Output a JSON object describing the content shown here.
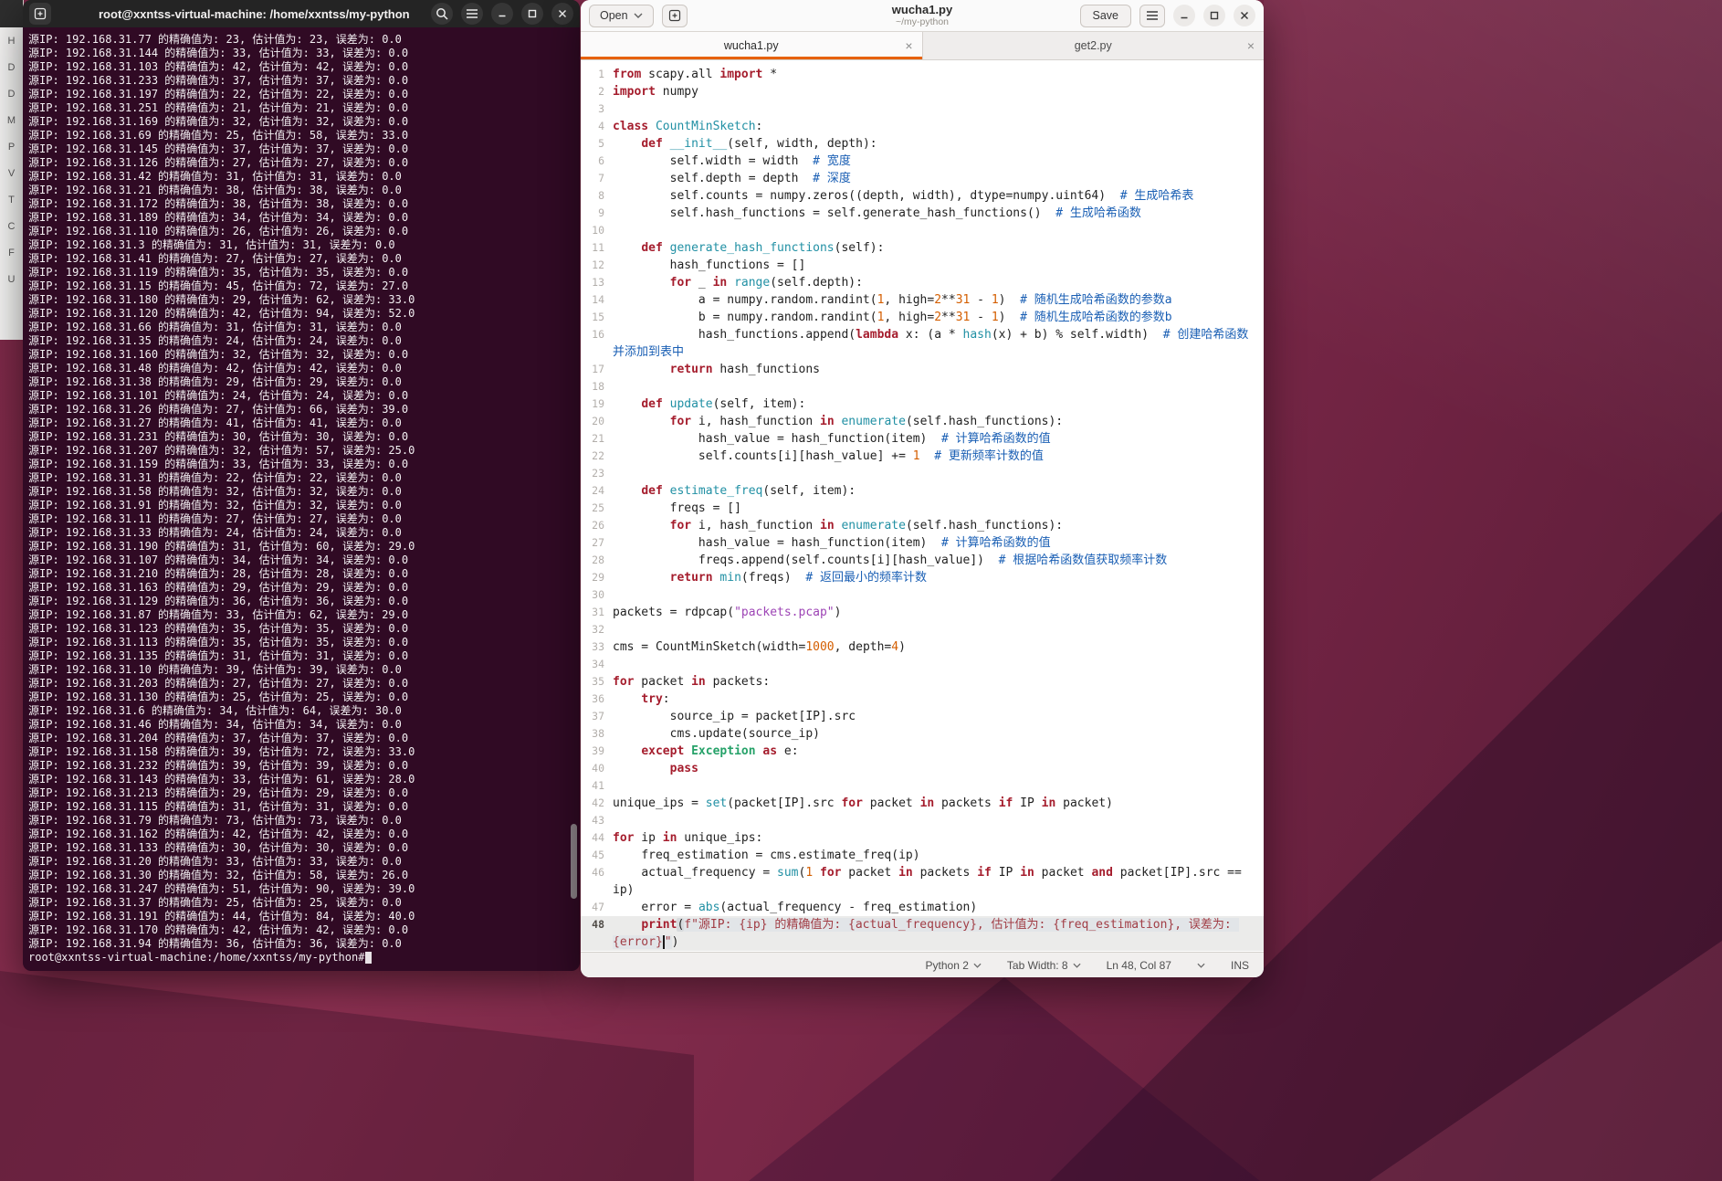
{
  "colors": {
    "accent_orange": "#e66100",
    "terminal_background": "#300a24",
    "desktop_base": "#7b2847",
    "keyword_red": "#a51d2d",
    "comment_blue": "#1a5fb4",
    "string_purple": "#9d44b5"
  },
  "icons": {
    "close": "×"
  },
  "background_strip": {
    "items": [
      "H",
      "D",
      "D",
      "M",
      "P",
      "V",
      "T",
      "C",
      "F",
      "U"
    ]
  },
  "terminal": {
    "header": {
      "title": "root@xxntss-virtual-machine: /home/xxntss/my-python"
    },
    "prompt": "root@xxntss-virtual-machine:/home/xxntss/my-python#",
    "lines": [
      "源IP: 192.168.31.77 的精确值为: 23, 估计值为: 23, 误差为: 0.0",
      "源IP: 192.168.31.144 的精确值为: 33, 估计值为: 33, 误差为: 0.0",
      "源IP: 192.168.31.103 的精确值为: 42, 估计值为: 42, 误差为: 0.0",
      "源IP: 192.168.31.233 的精确值为: 37, 估计值为: 37, 误差为: 0.0",
      "源IP: 192.168.31.197 的精确值为: 22, 估计值为: 22, 误差为: 0.0",
      "源IP: 192.168.31.251 的精确值为: 21, 估计值为: 21, 误差为: 0.0",
      "源IP: 192.168.31.169 的精确值为: 32, 估计值为: 32, 误差为: 0.0",
      "源IP: 192.168.31.69 的精确值为: 25, 估计值为: 58, 误差为: 33.0",
      "源IP: 192.168.31.145 的精确值为: 37, 估计值为: 37, 误差为: 0.0",
      "源IP: 192.168.31.126 的精确值为: 27, 估计值为: 27, 误差为: 0.0",
      "源IP: 192.168.31.42 的精确值为: 31, 估计值为: 31, 误差为: 0.0",
      "源IP: 192.168.31.21 的精确值为: 38, 估计值为: 38, 误差为: 0.0",
      "源IP: 192.168.31.172 的精确值为: 38, 估计值为: 38, 误差为: 0.0",
      "源IP: 192.168.31.189 的精确值为: 34, 估计值为: 34, 误差为: 0.0",
      "源IP: 192.168.31.110 的精确值为: 26, 估计值为: 26, 误差为: 0.0",
      "源IP: 192.168.31.3 的精确值为: 31, 估计值为: 31, 误差为: 0.0",
      "源IP: 192.168.31.41 的精确值为: 27, 估计值为: 27, 误差为: 0.0",
      "源IP: 192.168.31.119 的精确值为: 35, 估计值为: 35, 误差为: 0.0",
      "源IP: 192.168.31.15 的精确值为: 45, 估计值为: 72, 误差为: 27.0",
      "源IP: 192.168.31.180 的精确值为: 29, 估计值为: 62, 误差为: 33.0",
      "源IP: 192.168.31.120 的精确值为: 42, 估计值为: 94, 误差为: 52.0",
      "源IP: 192.168.31.66 的精确值为: 31, 估计值为: 31, 误差为: 0.0",
      "源IP: 192.168.31.35 的精确值为: 24, 估计值为: 24, 误差为: 0.0",
      "源IP: 192.168.31.160 的精确值为: 32, 估计值为: 32, 误差为: 0.0",
      "源IP: 192.168.31.48 的精确值为: 42, 估计值为: 42, 误差为: 0.0",
      "源IP: 192.168.31.38 的精确值为: 29, 估计值为: 29, 误差为: 0.0",
      "源IP: 192.168.31.101 的精确值为: 24, 估计值为: 24, 误差为: 0.0",
      "源IP: 192.168.31.26 的精确值为: 27, 估计值为: 66, 误差为: 39.0",
      "源IP: 192.168.31.27 的精确值为: 41, 估计值为: 41, 误差为: 0.0",
      "源IP: 192.168.31.231 的精确值为: 30, 估计值为: 30, 误差为: 0.0",
      "源IP: 192.168.31.207 的精确值为: 32, 估计值为: 57, 误差为: 25.0",
      "源IP: 192.168.31.159 的精确值为: 33, 估计值为: 33, 误差为: 0.0",
      "源IP: 192.168.31.31 的精确值为: 22, 估计值为: 22, 误差为: 0.0",
      "源IP: 192.168.31.58 的精确值为: 32, 估计值为: 32, 误差为: 0.0",
      "源IP: 192.168.31.91 的精确值为: 32, 估计值为: 32, 误差为: 0.0",
      "源IP: 192.168.31.11 的精确值为: 27, 估计值为: 27, 误差为: 0.0",
      "源IP: 192.168.31.33 的精确值为: 24, 估计值为: 24, 误差为: 0.0",
      "源IP: 192.168.31.190 的精确值为: 31, 估计值为: 60, 误差为: 29.0",
      "源IP: 192.168.31.107 的精确值为: 34, 估计值为: 34, 误差为: 0.0",
      "源IP: 192.168.31.210 的精确值为: 28, 估计值为: 28, 误差为: 0.0",
      "源IP: 192.168.31.163 的精确值为: 29, 估计值为: 29, 误差为: 0.0",
      "源IP: 192.168.31.129 的精确值为: 36, 估计值为: 36, 误差为: 0.0",
      "源IP: 192.168.31.87 的精确值为: 33, 估计值为: 62, 误差为: 29.0",
      "源IP: 192.168.31.123 的精确值为: 35, 估计值为: 35, 误差为: 0.0",
      "源IP: 192.168.31.113 的精确值为: 35, 估计值为: 35, 误差为: 0.0",
      "源IP: 192.168.31.135 的精确值为: 31, 估计值为: 31, 误差为: 0.0",
      "源IP: 192.168.31.10 的精确值为: 39, 估计值为: 39, 误差为: 0.0",
      "源IP: 192.168.31.203 的精确值为: 27, 估计值为: 27, 误差为: 0.0",
      "源IP: 192.168.31.130 的精确值为: 25, 估计值为: 25, 误差为: 0.0",
      "源IP: 192.168.31.6 的精确值为: 34, 估计值为: 64, 误差为: 30.0",
      "源IP: 192.168.31.46 的精确值为: 34, 估计值为: 34, 误差为: 0.0",
      "源IP: 192.168.31.204 的精确值为: 37, 估计值为: 37, 误差为: 0.0",
      "源IP: 192.168.31.158 的精确值为: 39, 估计值为: 72, 误差为: 33.0",
      "源IP: 192.168.31.232 的精确值为: 39, 估计值为: 39, 误差为: 0.0",
      "源IP: 192.168.31.143 的精确值为: 33, 估计值为: 61, 误差为: 28.0",
      "源IP: 192.168.31.213 的精确值为: 29, 估计值为: 29, 误差为: 0.0",
      "源IP: 192.168.31.115 的精确值为: 31, 估计值为: 31, 误差为: 0.0",
      "源IP: 192.168.31.79 的精确值为: 73, 估计值为: 73, 误差为: 0.0",
      "源IP: 192.168.31.162 的精确值为: 42, 估计值为: 42, 误差为: 0.0",
      "源IP: 192.168.31.133 的精确值为: 30, 估计值为: 30, 误差为: 0.0",
      "源IP: 192.168.31.20 的精确值为: 33, 估计值为: 33, 误差为: 0.0",
      "源IP: 192.168.31.30 的精确值为: 32, 估计值为: 58, 误差为: 26.0",
      "源IP: 192.168.31.247 的精确值为: 51, 估计值为: 90, 误差为: 39.0",
      "源IP: 192.168.31.37 的精确值为: 25, 估计值为: 25, 误差为: 0.0",
      "源IP: 192.168.31.191 的精确值为: 44, 估计值为: 84, 误差为: 40.0",
      "源IP: 192.168.31.170 的精确值为: 42, 估计值为: 42, 误差为: 0.0",
      "源IP: 192.168.31.94 的精确值为: 36, 估计值为: 36, 误差为: 0.0"
    ]
  },
  "editor": {
    "header": {
      "open_label": "Open",
      "title": "wucha1.py",
      "subtitle": "~/my-python",
      "save_label": "Save"
    },
    "tabs": [
      {
        "label": "wucha1.py",
        "active": true
      },
      {
        "label": "get2.py",
        "active": false
      }
    ],
    "status": {
      "language": "Python 2",
      "tab_width": "Tab Width: 8",
      "position": "Ln 48, Col 87",
      "mode": "INS"
    },
    "code": [
      {
        "n": 1,
        "tok": [
          [
            "k",
            "from"
          ],
          [
            "t",
            " scapy.all "
          ],
          [
            "k",
            "import"
          ],
          [
            "t",
            " *"
          ]
        ]
      },
      {
        "n": 2,
        "tok": [
          [
            "k",
            "import"
          ],
          [
            "t",
            " numpy"
          ]
        ]
      },
      {
        "n": 3,
        "tok": []
      },
      {
        "n": 4,
        "tok": [
          [
            "k",
            "class"
          ],
          [
            "t",
            " "
          ],
          [
            "fn",
            "CountMinSketch"
          ],
          [
            "t",
            ":"
          ]
        ]
      },
      {
        "n": 5,
        "tok": [
          [
            "t",
            "    "
          ],
          [
            "k",
            "def"
          ],
          [
            "t",
            " "
          ],
          [
            "fn",
            "__init__"
          ],
          [
            "t",
            "(self, width, depth):"
          ]
        ]
      },
      {
        "n": 6,
        "tok": [
          [
            "t",
            "        self.width = width  "
          ],
          [
            "c",
            "# 宽度"
          ]
        ]
      },
      {
        "n": 7,
        "tok": [
          [
            "t",
            "        self.depth = depth  "
          ],
          [
            "c",
            "# 深度"
          ]
        ]
      },
      {
        "n": 8,
        "tok": [
          [
            "t",
            "        self.counts = numpy.zeros((depth, width), dtype=numpy.uint64)  "
          ],
          [
            "c",
            "# 生成哈希表"
          ]
        ]
      },
      {
        "n": 9,
        "tok": [
          [
            "t",
            "        self.hash_functions = self.generate_hash_functions()  "
          ],
          [
            "c",
            "# 生成哈希函数"
          ]
        ]
      },
      {
        "n": 10,
        "tok": []
      },
      {
        "n": 11,
        "tok": [
          [
            "t",
            "    "
          ],
          [
            "k",
            "def"
          ],
          [
            "t",
            " "
          ],
          [
            "fn",
            "generate_hash_functions"
          ],
          [
            "t",
            "(self):"
          ]
        ]
      },
      {
        "n": 12,
        "tok": [
          [
            "t",
            "        hash_functions = []"
          ]
        ]
      },
      {
        "n": 13,
        "tok": [
          [
            "t",
            "        "
          ],
          [
            "k",
            "for"
          ],
          [
            "t",
            " _ "
          ],
          [
            "k",
            "in"
          ],
          [
            "t",
            " "
          ],
          [
            "fn",
            "range"
          ],
          [
            "t",
            "(self.depth):"
          ]
        ]
      },
      {
        "n": 14,
        "tok": [
          [
            "t",
            "            a = numpy.random.randint("
          ],
          [
            "n",
            "1"
          ],
          [
            "t",
            ", high="
          ],
          [
            "n",
            "2"
          ],
          [
            "t",
            "**"
          ],
          [
            "n",
            "31"
          ],
          [
            "t",
            " - "
          ],
          [
            "n",
            "1"
          ],
          [
            "t",
            ")  "
          ],
          [
            "c",
            "# 随机生成哈希函数的参数a"
          ]
        ]
      },
      {
        "n": 15,
        "tok": [
          [
            "t",
            "            b = numpy.random.randint("
          ],
          [
            "n",
            "1"
          ],
          [
            "t",
            ", high="
          ],
          [
            "n",
            "2"
          ],
          [
            "t",
            "**"
          ],
          [
            "n",
            "31"
          ],
          [
            "t",
            " - "
          ],
          [
            "n",
            "1"
          ],
          [
            "t",
            ")  "
          ],
          [
            "c",
            "# 随机生成哈希函数的参数b"
          ]
        ]
      },
      {
        "n": 16,
        "tok": [
          [
            "t",
            "            hash_functions.append("
          ],
          [
            "k",
            "lambda"
          ],
          [
            "t",
            " x: (a * "
          ],
          [
            "fn",
            "hash"
          ],
          [
            "t",
            "(x) + b) % self.width)  "
          ],
          [
            "c",
            "# 创建哈希函数并添加到表中"
          ]
        ]
      },
      {
        "n": 17,
        "tok": [
          [
            "t",
            "        "
          ],
          [
            "k",
            "return"
          ],
          [
            "t",
            " hash_functions"
          ]
        ]
      },
      {
        "n": 18,
        "tok": []
      },
      {
        "n": 19,
        "tok": [
          [
            "t",
            "    "
          ],
          [
            "k",
            "def"
          ],
          [
            "t",
            " "
          ],
          [
            "fn",
            "update"
          ],
          [
            "t",
            "(self, item):"
          ]
        ]
      },
      {
        "n": 20,
        "tok": [
          [
            "t",
            "        "
          ],
          [
            "k",
            "for"
          ],
          [
            "t",
            " i, hash_function "
          ],
          [
            "k",
            "in"
          ],
          [
            "t",
            " "
          ],
          [
            "fn",
            "enumerate"
          ],
          [
            "t",
            "(self.hash_functions):"
          ]
        ]
      },
      {
        "n": 21,
        "tok": [
          [
            "t",
            "            hash_value = hash_function(item)  "
          ],
          [
            "c",
            "# 计算哈希函数的值"
          ]
        ]
      },
      {
        "n": 22,
        "tok": [
          [
            "t",
            "            self.counts[i][hash_value] += "
          ],
          [
            "n",
            "1"
          ],
          [
            "t",
            "  "
          ],
          [
            "c",
            "# 更新频率计数的值"
          ]
        ]
      },
      {
        "n": 23,
        "tok": []
      },
      {
        "n": 24,
        "tok": [
          [
            "t",
            "    "
          ],
          [
            "k",
            "def"
          ],
          [
            "t",
            " "
          ],
          [
            "fn",
            "estimate_freq"
          ],
          [
            "t",
            "(self, item):"
          ]
        ]
      },
      {
        "n": 25,
        "tok": [
          [
            "t",
            "        freqs = []"
          ]
        ]
      },
      {
        "n": 26,
        "tok": [
          [
            "t",
            "        "
          ],
          [
            "k",
            "for"
          ],
          [
            "t",
            " i, hash_function "
          ],
          [
            "k",
            "in"
          ],
          [
            "t",
            " "
          ],
          [
            "fn",
            "enumerate"
          ],
          [
            "t",
            "(self.hash_functions):"
          ]
        ]
      },
      {
        "n": 27,
        "tok": [
          [
            "t",
            "            hash_value = hash_function(item)  "
          ],
          [
            "c",
            "# 计算哈希函数的值"
          ]
        ]
      },
      {
        "n": 28,
        "tok": [
          [
            "t",
            "            freqs.append(self.counts[i][hash_value])  "
          ],
          [
            "c",
            "# 根据哈希函数值获取频率计数"
          ]
        ]
      },
      {
        "n": 29,
        "tok": [
          [
            "t",
            "        "
          ],
          [
            "k",
            "return"
          ],
          [
            "t",
            " "
          ],
          [
            "fn",
            "min"
          ],
          [
            "t",
            "(freqs)  "
          ],
          [
            "c",
            "# 返回最小的频率计数"
          ]
        ]
      },
      {
        "n": 30,
        "tok": []
      },
      {
        "n": 31,
        "tok": [
          [
            "t",
            "packets = rdpcap("
          ],
          [
            "s",
            "\"packets.pcap\""
          ],
          [
            "t",
            ")"
          ]
        ]
      },
      {
        "n": 32,
        "tok": []
      },
      {
        "n": 33,
        "tok": [
          [
            "t",
            "cms = CountMinSketch(width="
          ],
          [
            "n",
            "1000"
          ],
          [
            "t",
            ", depth="
          ],
          [
            "n",
            "4"
          ],
          [
            "t",
            ")"
          ]
        ]
      },
      {
        "n": 34,
        "tok": []
      },
      {
        "n": 35,
        "tok": [
          [
            "k",
            "for"
          ],
          [
            "t",
            " packet "
          ],
          [
            "k",
            "in"
          ],
          [
            "t",
            " packets:"
          ]
        ]
      },
      {
        "n": 36,
        "tok": [
          [
            "t",
            "    "
          ],
          [
            "k",
            "try"
          ],
          [
            "t",
            ":"
          ]
        ]
      },
      {
        "n": 37,
        "tok": [
          [
            "t",
            "        source_ip = packet[IP].src"
          ]
        ]
      },
      {
        "n": 38,
        "tok": [
          [
            "t",
            "        cms.update(source_ip)"
          ]
        ]
      },
      {
        "n": 39,
        "tok": [
          [
            "t",
            "    "
          ],
          [
            "k",
            "except"
          ],
          [
            "t",
            " "
          ],
          [
            "e",
            "Exception"
          ],
          [
            "t",
            " "
          ],
          [
            "k",
            "as"
          ],
          [
            "t",
            " e:"
          ]
        ]
      },
      {
        "n": 40,
        "tok": [
          [
            "t",
            "        "
          ],
          [
            "k",
            "pass"
          ]
        ]
      },
      {
        "n": 41,
        "tok": []
      },
      {
        "n": 42,
        "tok": [
          [
            "t",
            "unique_ips = "
          ],
          [
            "fn",
            "set"
          ],
          [
            "t",
            "(packet[IP].src "
          ],
          [
            "k",
            "for"
          ],
          [
            "t",
            " packet "
          ],
          [
            "k",
            "in"
          ],
          [
            "t",
            " packets "
          ],
          [
            "k",
            "if"
          ],
          [
            "t",
            " IP "
          ],
          [
            "k",
            "in"
          ],
          [
            "t",
            " packet)"
          ]
        ]
      },
      {
        "n": 43,
        "tok": []
      },
      {
        "n": 44,
        "tok": [
          [
            "k",
            "for"
          ],
          [
            "t",
            " ip "
          ],
          [
            "k",
            "in"
          ],
          [
            "t",
            " unique_ips:"
          ]
        ]
      },
      {
        "n": 45,
        "tok": [
          [
            "t",
            "    freq_estimation = cms.estimate_freq(ip)"
          ]
        ]
      },
      {
        "n": 46,
        "tok": [
          [
            "t",
            "    actual_frequency = "
          ],
          [
            "fn",
            "sum"
          ],
          [
            "t",
            "("
          ],
          [
            "n",
            "1"
          ],
          [
            "t",
            " "
          ],
          [
            "k",
            "for"
          ],
          [
            "t",
            " packet "
          ],
          [
            "k",
            "in"
          ],
          [
            "t",
            " packets "
          ],
          [
            "k",
            "if"
          ],
          [
            "t",
            " IP "
          ],
          [
            "k",
            "in"
          ],
          [
            "t",
            " packet "
          ],
          [
            "k",
            "and"
          ],
          [
            "t",
            " packet[IP].src == ip)"
          ]
        ]
      },
      {
        "n": 47,
        "tok": [
          [
            "t",
            "    error = "
          ],
          [
            "fn",
            "abs"
          ],
          [
            "t",
            "(actual_frequency - freq_estimation)"
          ]
        ]
      },
      {
        "n": 48,
        "hl": true,
        "tok": [
          [
            "t",
            "    "
          ],
          [
            "k",
            "print"
          ],
          [
            "bm",
            "("
          ],
          [
            "fs",
            "f\"源IP: {ip} 的精确值为: {actual_frequency}, 估计值为: {freq_estimation}, 误差为: {error}"
          ],
          [
            "caret",
            ""
          ],
          [
            "fs",
            "\""
          ],
          [
            "t",
            ")"
          ]
        ]
      }
    ]
  }
}
